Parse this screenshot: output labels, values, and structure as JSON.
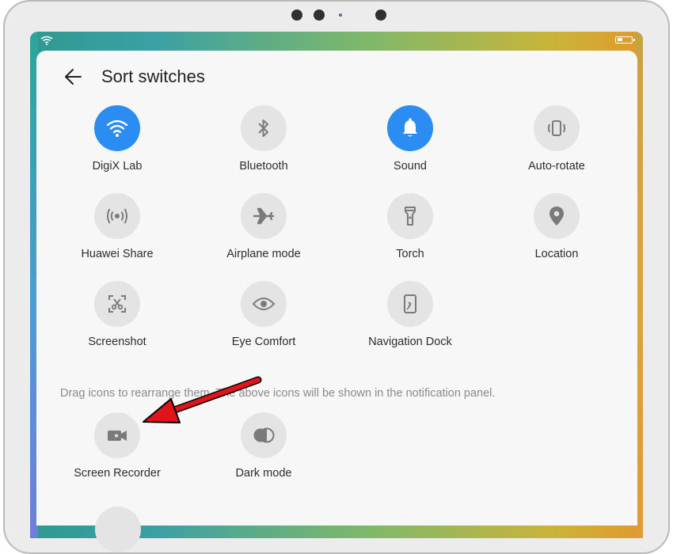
{
  "page": {
    "title": "Sort switches",
    "hint": "Drag icons to rearrange them. The above icons will be shown in the notification panel."
  },
  "switches": [
    {
      "label": "DigiX Lab",
      "icon": "wifi-icon",
      "on": true
    },
    {
      "label": "Bluetooth",
      "icon": "bluetooth-icon",
      "on": false
    },
    {
      "label": "Sound",
      "icon": "bell-icon",
      "on": true
    },
    {
      "label": "Auto-rotate",
      "icon": "auto-rotate-icon",
      "on": false
    },
    {
      "label": "Huawei Share",
      "icon": "huawei-share-icon",
      "on": false
    },
    {
      "label": "Airplane mode",
      "icon": "airplane-icon",
      "on": false
    },
    {
      "label": "Torch",
      "icon": "torch-icon",
      "on": false
    },
    {
      "label": "Location",
      "icon": "location-pin-icon",
      "on": false
    },
    {
      "label": "Screenshot",
      "icon": "screenshot-icon",
      "on": false
    },
    {
      "label": "Eye Comfort",
      "icon": "eye-icon",
      "on": false
    },
    {
      "label": "Navigation Dock",
      "icon": "navigation-dock-icon",
      "on": false
    }
  ],
  "hidden_switches": [
    {
      "label": "Screen Recorder",
      "icon": "video-camera-icon"
    },
    {
      "label": "Dark mode",
      "icon": "dark-mode-icon"
    }
  ],
  "colors": {
    "active": "#2b8cf2",
    "inactive": "#e4e4e4",
    "annotation_arrow": "#e0141b"
  }
}
